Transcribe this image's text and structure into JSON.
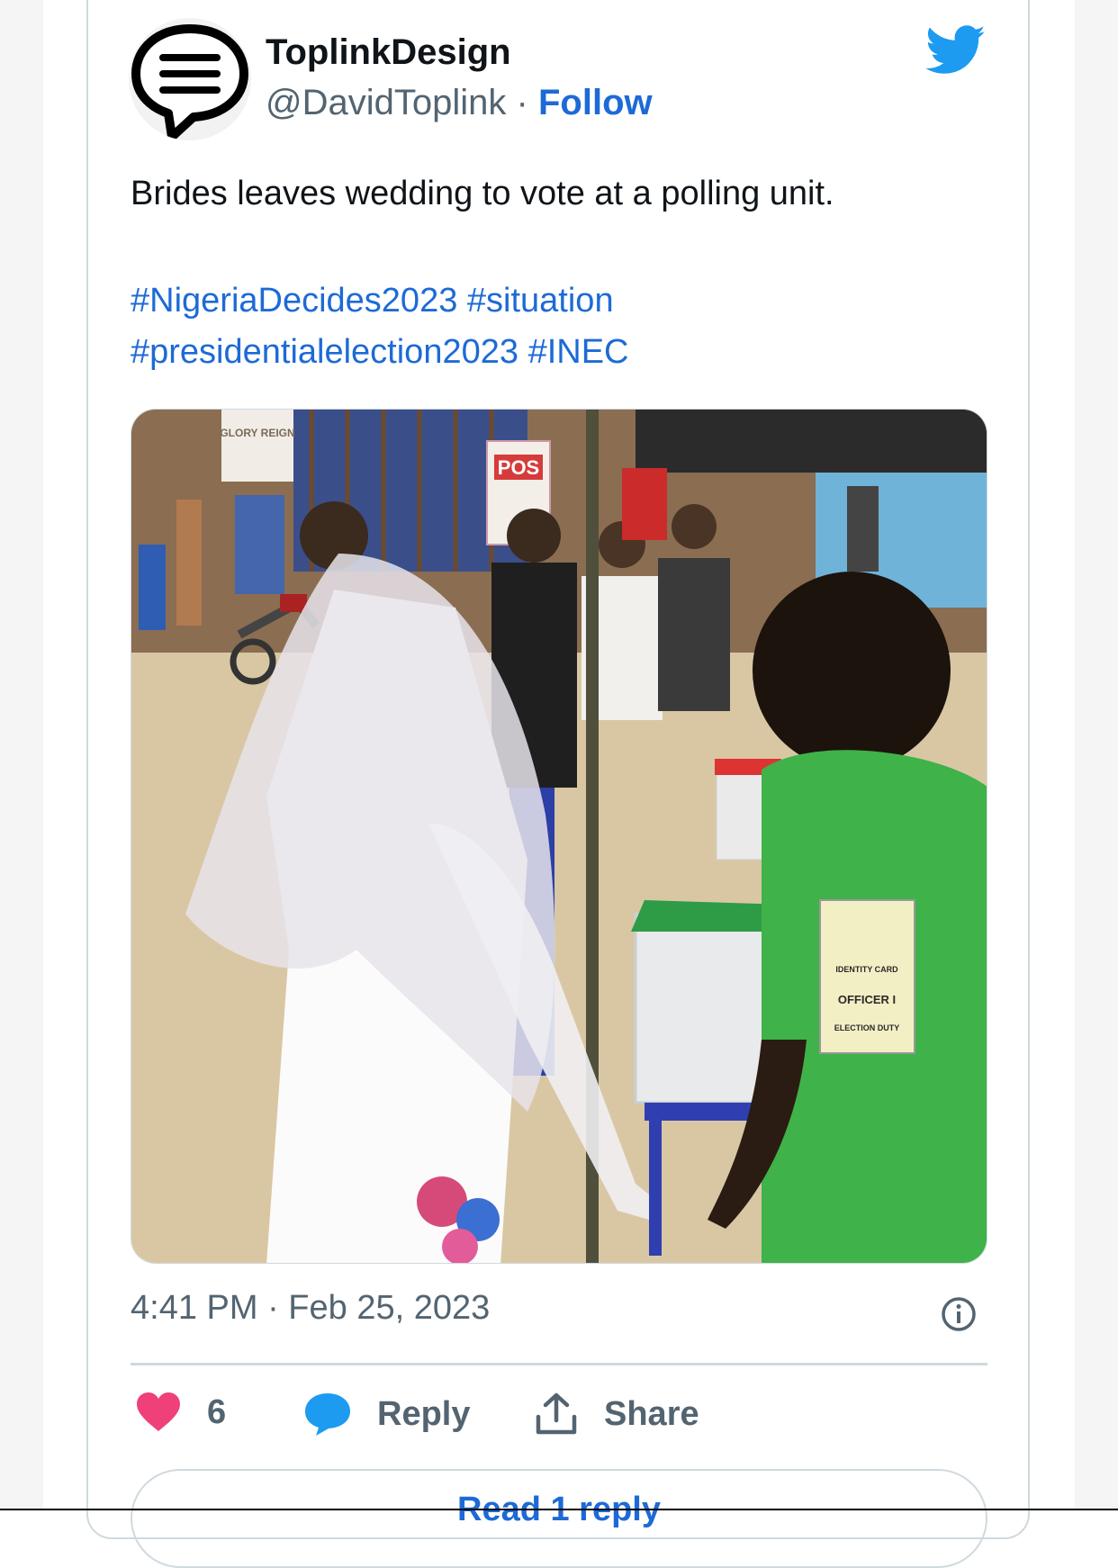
{
  "author": {
    "display_name": "ToplinkDesign",
    "handle": "@DavidToplink",
    "separator": "·",
    "follow_label": "Follow"
  },
  "tweet": {
    "text": "Brides leaves wedding to vote at a polling unit.",
    "hashtags": [
      "#NigeriaDecides2023",
      "#situation",
      "#presidentialelection2023",
      "#INEC"
    ],
    "timestamp": "4:41 PM · Feb 25, 2023"
  },
  "actions": {
    "like_count": "6",
    "reply_label": "Reply",
    "share_label": "Share"
  },
  "read_replies_label": "Read 1 reply",
  "photo": {
    "sign_glory": "GLORY REIGN",
    "sign_pos": "POS",
    "badge_identity": "IDENTITY CARD",
    "badge_role": "OFFICER I",
    "badge_duty": "ELECTION DUTY"
  },
  "colors": {
    "link": "#1d6ad6",
    "like_heart": "#f0407a",
    "twitter_blue": "#1d9bf0",
    "muted": "#536471"
  },
  "icons": {
    "avatar": "chat-bubble-logo-icon",
    "brand": "twitter-bird-icon",
    "info": "info-icon",
    "like": "heart-icon",
    "reply": "speech-bubble-icon",
    "share": "share-upload-icon"
  }
}
